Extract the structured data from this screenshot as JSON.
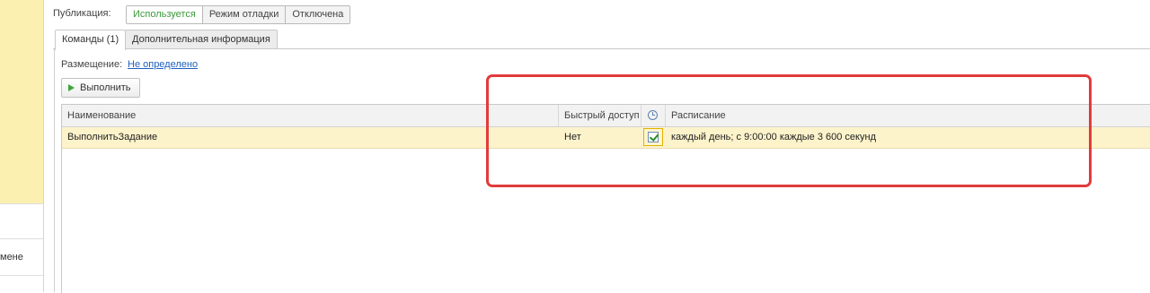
{
  "left_panel": {
    "item_text": "мене"
  },
  "publication": {
    "label": "Публикация:",
    "options": [
      "Используется",
      "Режим отладки",
      "Отключена"
    ],
    "selected": "Используется"
  },
  "tabs": [
    {
      "label": "Команды (1)",
      "active": true
    },
    {
      "label": "Дополнительная информация",
      "active": false
    }
  ],
  "placement": {
    "label": "Размещение:",
    "value": "Не определено"
  },
  "toolbar": {
    "run_label": "Выполнить"
  },
  "table": {
    "columns": [
      "Наименование",
      "Быстрый доступ",
      "clock-icon",
      "Расписание"
    ],
    "rows": [
      {
        "name": "ВыполнитьЗадание",
        "quick_access": "Нет",
        "scheduled": true,
        "schedule": "каждый день; с 9:00:00 каждые 3 600 секунд"
      }
    ]
  },
  "colors": {
    "active_option": "#3a9a3a",
    "link": "#2060c0",
    "selected_row": "#fdf3cb",
    "left_panel": "#fbf0b0",
    "highlight": "#e23b3b"
  }
}
